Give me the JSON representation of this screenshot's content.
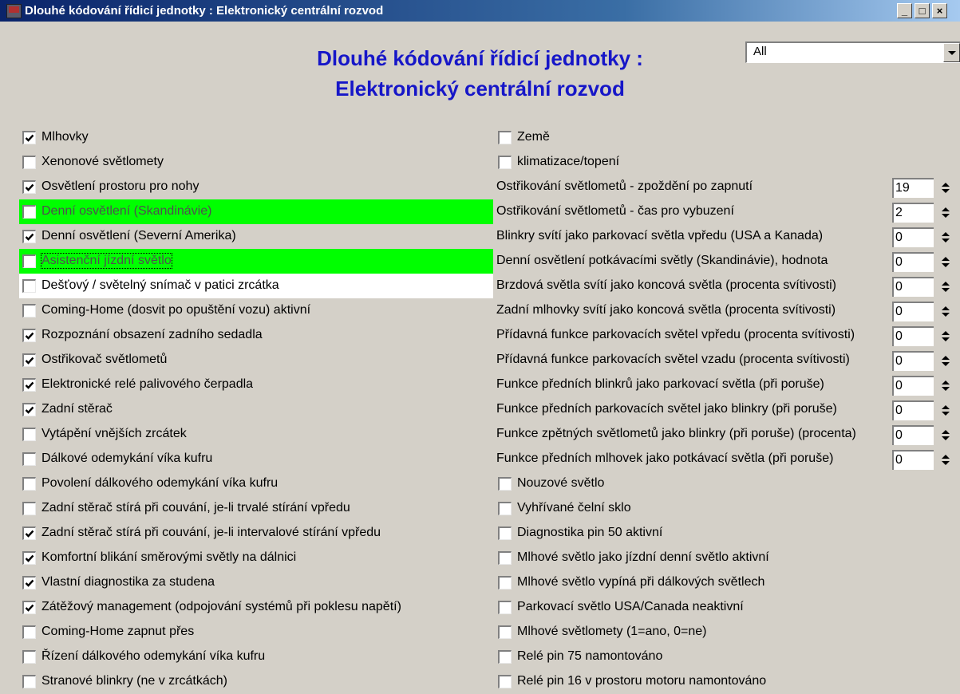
{
  "window": {
    "title": "Dlouhé kódování řídicí jednotky : Elektronický centrální rozvod",
    "minimize": "_",
    "maximize": "□",
    "close": "×"
  },
  "heading": {
    "line1": "Dlouhé kódování řídicí jednotky :",
    "line2": "Elektronický centrální rozvod"
  },
  "filter": {
    "value": "All"
  },
  "left_checks": [
    {
      "label": "Mlhovky",
      "checked": true
    },
    {
      "label": "Xenonové světlomety",
      "checked": false
    },
    {
      "label": "Osvětlení prostoru pro nohy",
      "checked": true
    },
    {
      "label": "Denní osvětlení (Skandinávie)",
      "checked": false,
      "highlight": "green"
    },
    {
      "label": "Denní osvětlení (Severní Amerika)",
      "checked": true
    },
    {
      "label": "Asistenční jízdní světlo",
      "checked": false,
      "highlight": "green",
      "focused": true
    },
    {
      "label": "Dešťový / světelný snímač v patici zrcátka",
      "checked": false,
      "highlight": "white"
    },
    {
      "label": "Coming-Home (dosvit po opuštění vozu) aktivní",
      "checked": false
    },
    {
      "label": "Rozpoznání obsazení zadního sedadla",
      "checked": true
    },
    {
      "label": "Ostřikovač světlometů",
      "checked": true
    },
    {
      "label": "Elektronické relé palivového čerpadla",
      "checked": true
    },
    {
      "label": "Zadní stěrač",
      "checked": true
    },
    {
      "label": "Vytápění vnějších zrcátek",
      "checked": false
    },
    {
      "label": "Dálkové odemykání víka kufru",
      "checked": false
    },
    {
      "label": "Povolení dálkového odemykání víka kufru",
      "checked": false
    },
    {
      "label": "Zadní stěrač stírá při couvání, je-li trvalé stírání vpředu",
      "checked": false
    },
    {
      "label": "Zadní stěrač stírá při couvání, je-li intervalové stírání vpředu",
      "checked": true
    },
    {
      "label": "Komfortní blikání směrovými světly na dálnici",
      "checked": true
    },
    {
      "label": "Vlastní diagnostika za studena",
      "checked": true
    },
    {
      "label": "Zátěžový management (odpojování systémů při poklesu napětí)",
      "checked": true
    },
    {
      "label": "Coming-Home zapnut přes",
      "checked": false
    },
    {
      "label": "Řízení dálkového odemykání víka kufru",
      "checked": false
    },
    {
      "label": "Stranové blinkry (ne v zrcátkách)",
      "checked": false
    }
  ],
  "right_top_checks": [
    {
      "label": "Země",
      "checked": false
    },
    {
      "label": "klimatizace/topení",
      "checked": false
    }
  ],
  "right_params": [
    {
      "label": "Ostřikování světlometů - zpoždění po zapnutí",
      "value": "19"
    },
    {
      "label": "Ostřikování světlometů - čas pro vybuzení",
      "value": "2"
    },
    {
      "label": "Blinkry svítí jako parkovací světla vpředu (USA a Kanada)",
      "value": "0"
    },
    {
      "label": "Denní osvětlení potkávacími světly (Skandinávie), hodnota",
      "value": "0"
    },
    {
      "label": "Brzdová světla svítí jako koncová světla (procenta svítivosti)",
      "value": "0"
    },
    {
      "label": "Zadní mlhovky svítí jako koncová světla (procenta svítivosti)",
      "value": "0"
    },
    {
      "label": "Přídavná funkce parkovacích světel vpředu (procenta svítivosti)",
      "value": "0"
    },
    {
      "label": "Přídavná funkce parkovacích světel vzadu (procenta svítivosti)",
      "value": "0"
    },
    {
      "label": "Funkce předních blinkrů jako parkovací světla (při poruše)",
      "value": "0"
    },
    {
      "label": "Funkce předních parkovacích světel jako blinkry (při poruše)",
      "value": "0"
    },
    {
      "label": "Funkce zpětných světlometů jako blinkry (při poruše) (procenta)",
      "value": "0"
    },
    {
      "label": "Funkce předních mlhovek jako potkávací světla (při poruše)",
      "value": "0"
    }
  ],
  "right_bottom_checks": [
    {
      "label": "Nouzové světlo",
      "checked": false
    },
    {
      "label": "Vyhřívané čelní sklo",
      "checked": false
    },
    {
      "label": "Diagnostika pin 50 aktivní",
      "checked": false
    },
    {
      "label": "Mlhové světlo jako jízdní denní světlo aktivní",
      "checked": false
    },
    {
      "label": "Mlhové světlo vypíná při dálkových světlech",
      "checked": false
    },
    {
      "label": "Parkovací světlo USA/Canada neaktivní",
      "checked": false
    },
    {
      "label": "Mlhové světlomety (1=ano, 0=ne)",
      "checked": false
    },
    {
      "label": "Relé pin 75 namontováno",
      "checked": false
    },
    {
      "label": "Relé pin 16 v prostoru motoru namontováno",
      "checked": false
    }
  ]
}
